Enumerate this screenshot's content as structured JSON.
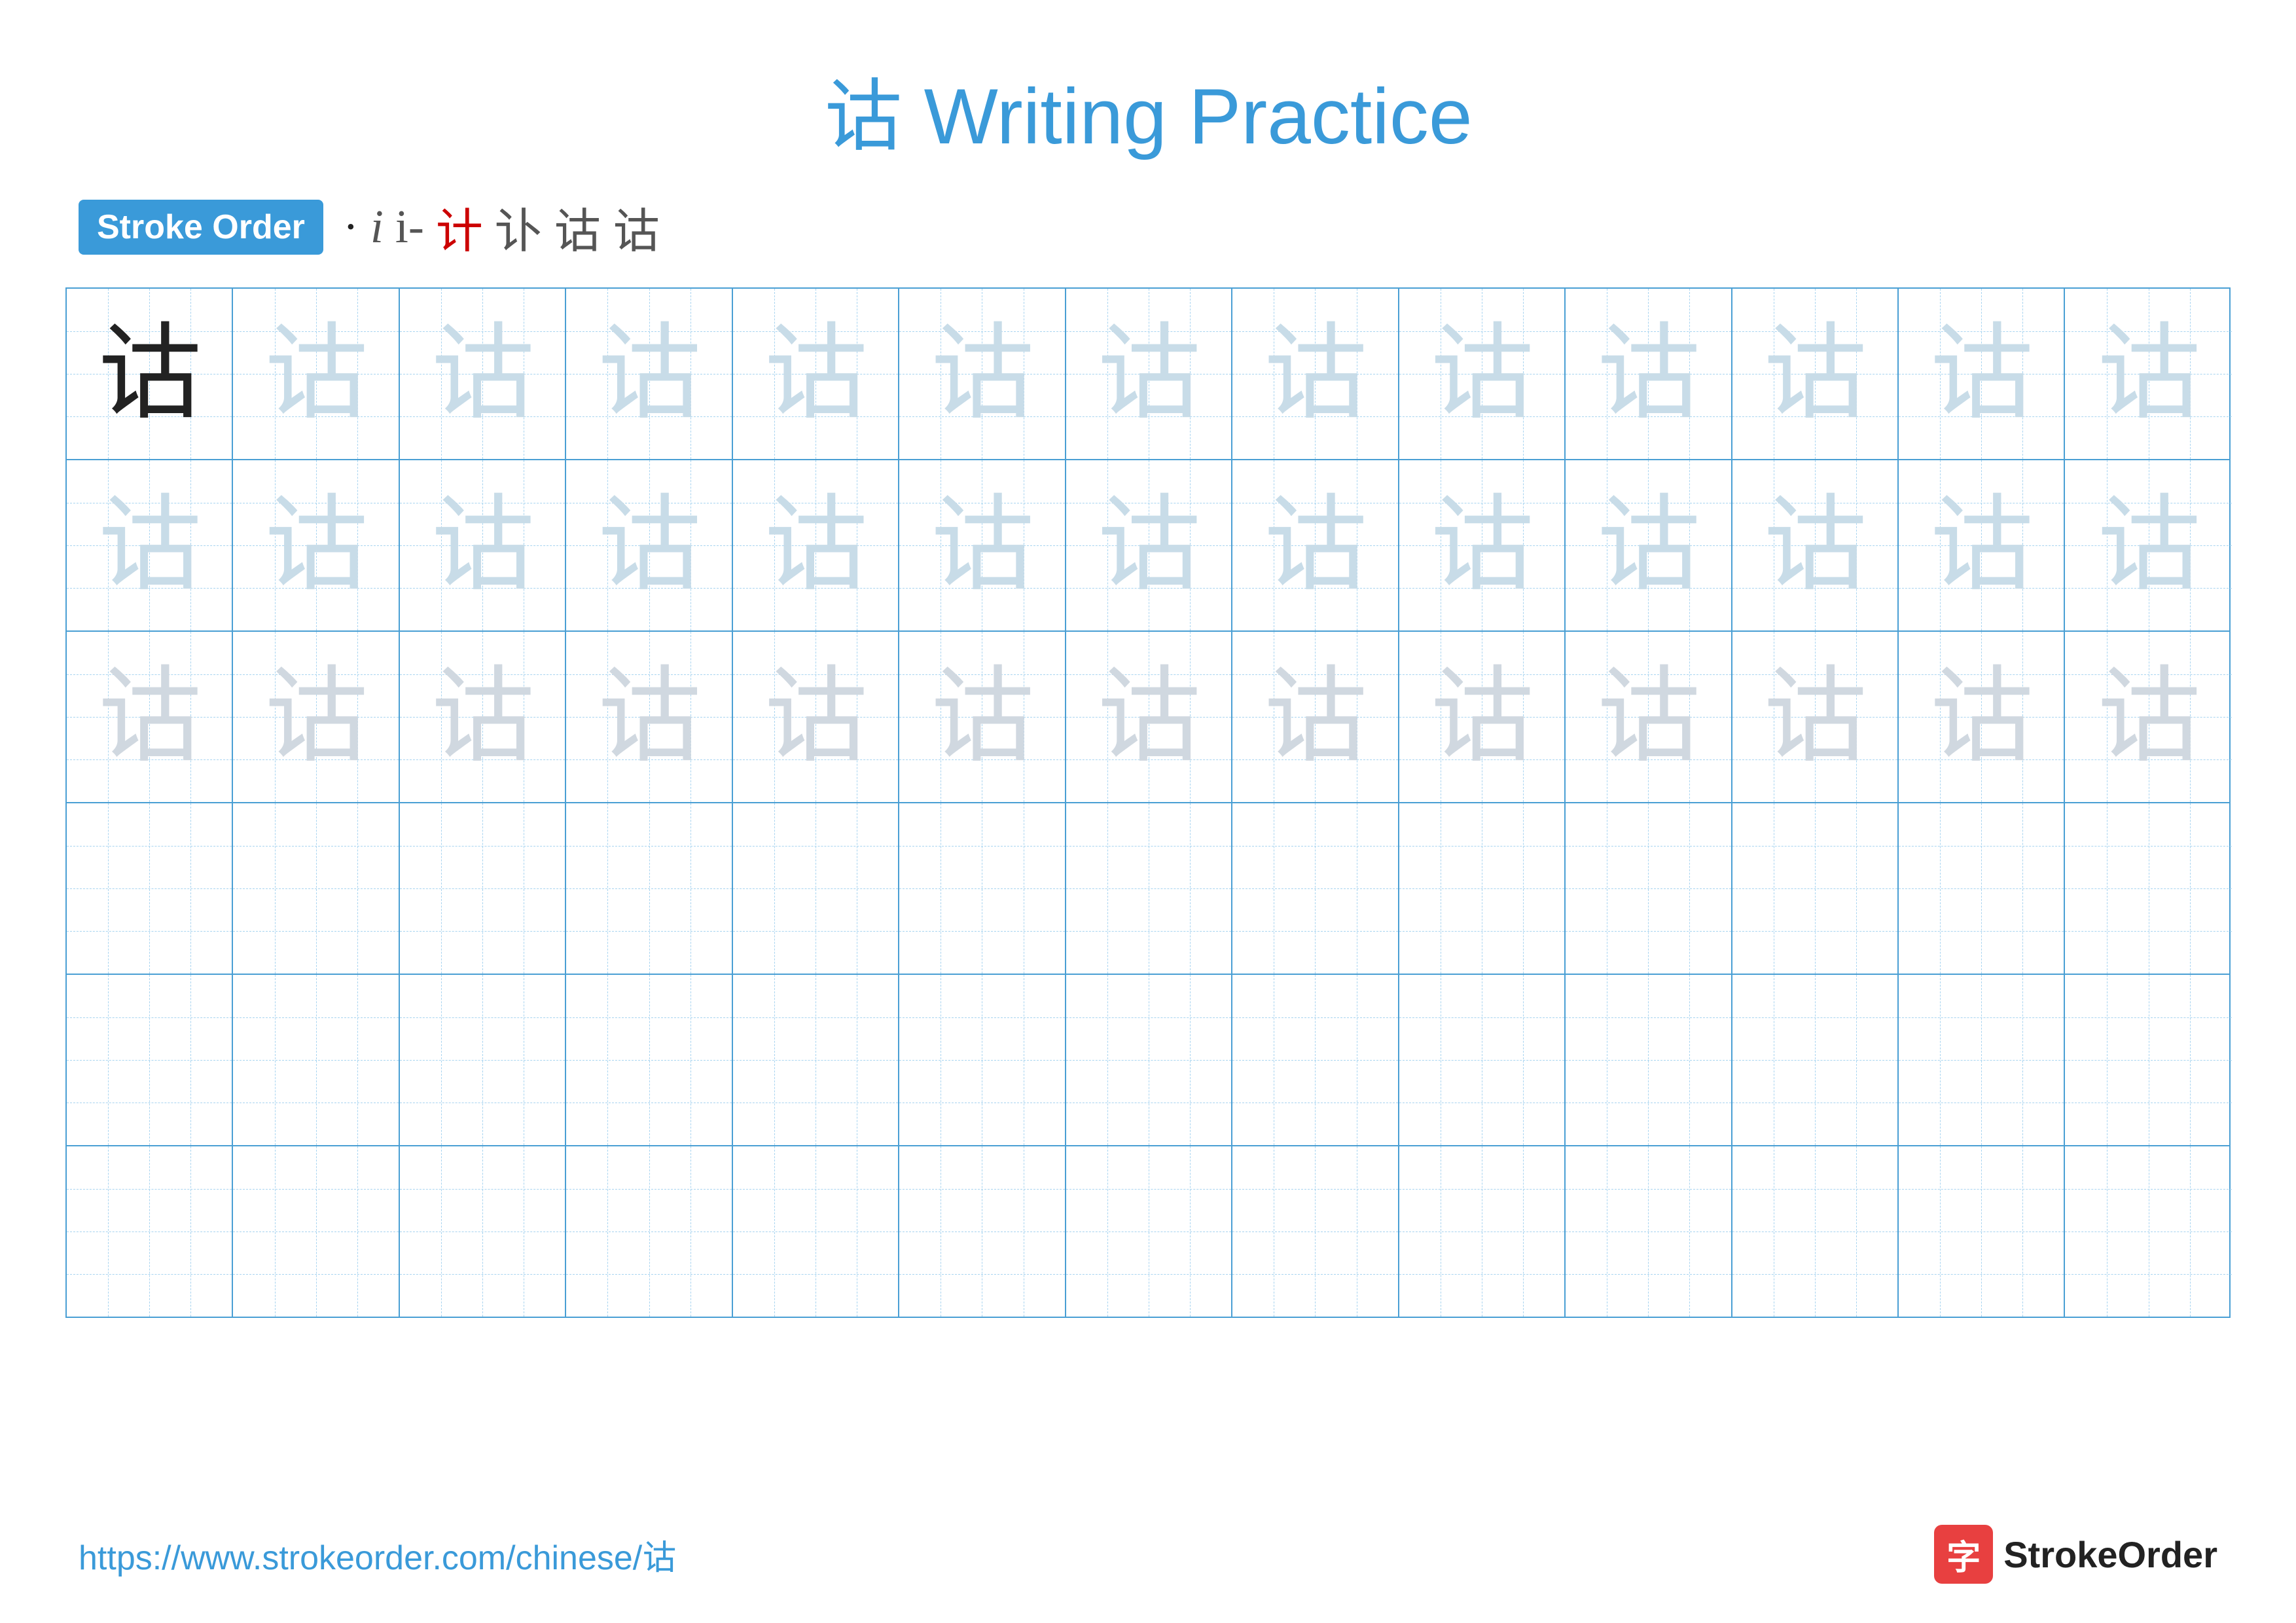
{
  "title": {
    "char": "诂",
    "text": "Writing Practice",
    "full": "诂 Writing Practice"
  },
  "stroke_order": {
    "badge_label": "Stroke Order",
    "strokes": [
      "·",
      "i",
      "i-",
      "计",
      "讣",
      "诂",
      "诂"
    ]
  },
  "grid": {
    "rows": 6,
    "cols": 13,
    "char": "诂",
    "row_styles": [
      [
        "solid",
        "light1",
        "light1",
        "light1",
        "light1",
        "light1",
        "light1",
        "light1",
        "light1",
        "light1",
        "light1",
        "light1",
        "light1"
      ],
      [
        "light1",
        "light1",
        "light1",
        "light1",
        "light1",
        "light1",
        "light1",
        "light1",
        "light1",
        "light1",
        "light1",
        "light1",
        "light1"
      ],
      [
        "light2",
        "light2",
        "light2",
        "light2",
        "light2",
        "light2",
        "light2",
        "light2",
        "light2",
        "light2",
        "light2",
        "light2",
        "light2"
      ],
      [
        "empty",
        "empty",
        "empty",
        "empty",
        "empty",
        "empty",
        "empty",
        "empty",
        "empty",
        "empty",
        "empty",
        "empty",
        "empty"
      ],
      [
        "empty",
        "empty",
        "empty",
        "empty",
        "empty",
        "empty",
        "empty",
        "empty",
        "empty",
        "empty",
        "empty",
        "empty",
        "empty"
      ],
      [
        "empty",
        "empty",
        "empty",
        "empty",
        "empty",
        "empty",
        "empty",
        "empty",
        "empty",
        "empty",
        "empty",
        "empty",
        "empty"
      ]
    ]
  },
  "footer": {
    "url": "https://www.strokeorder.com/chinese/诂",
    "logo_char": "字",
    "logo_text": "StrokeOrder"
  }
}
